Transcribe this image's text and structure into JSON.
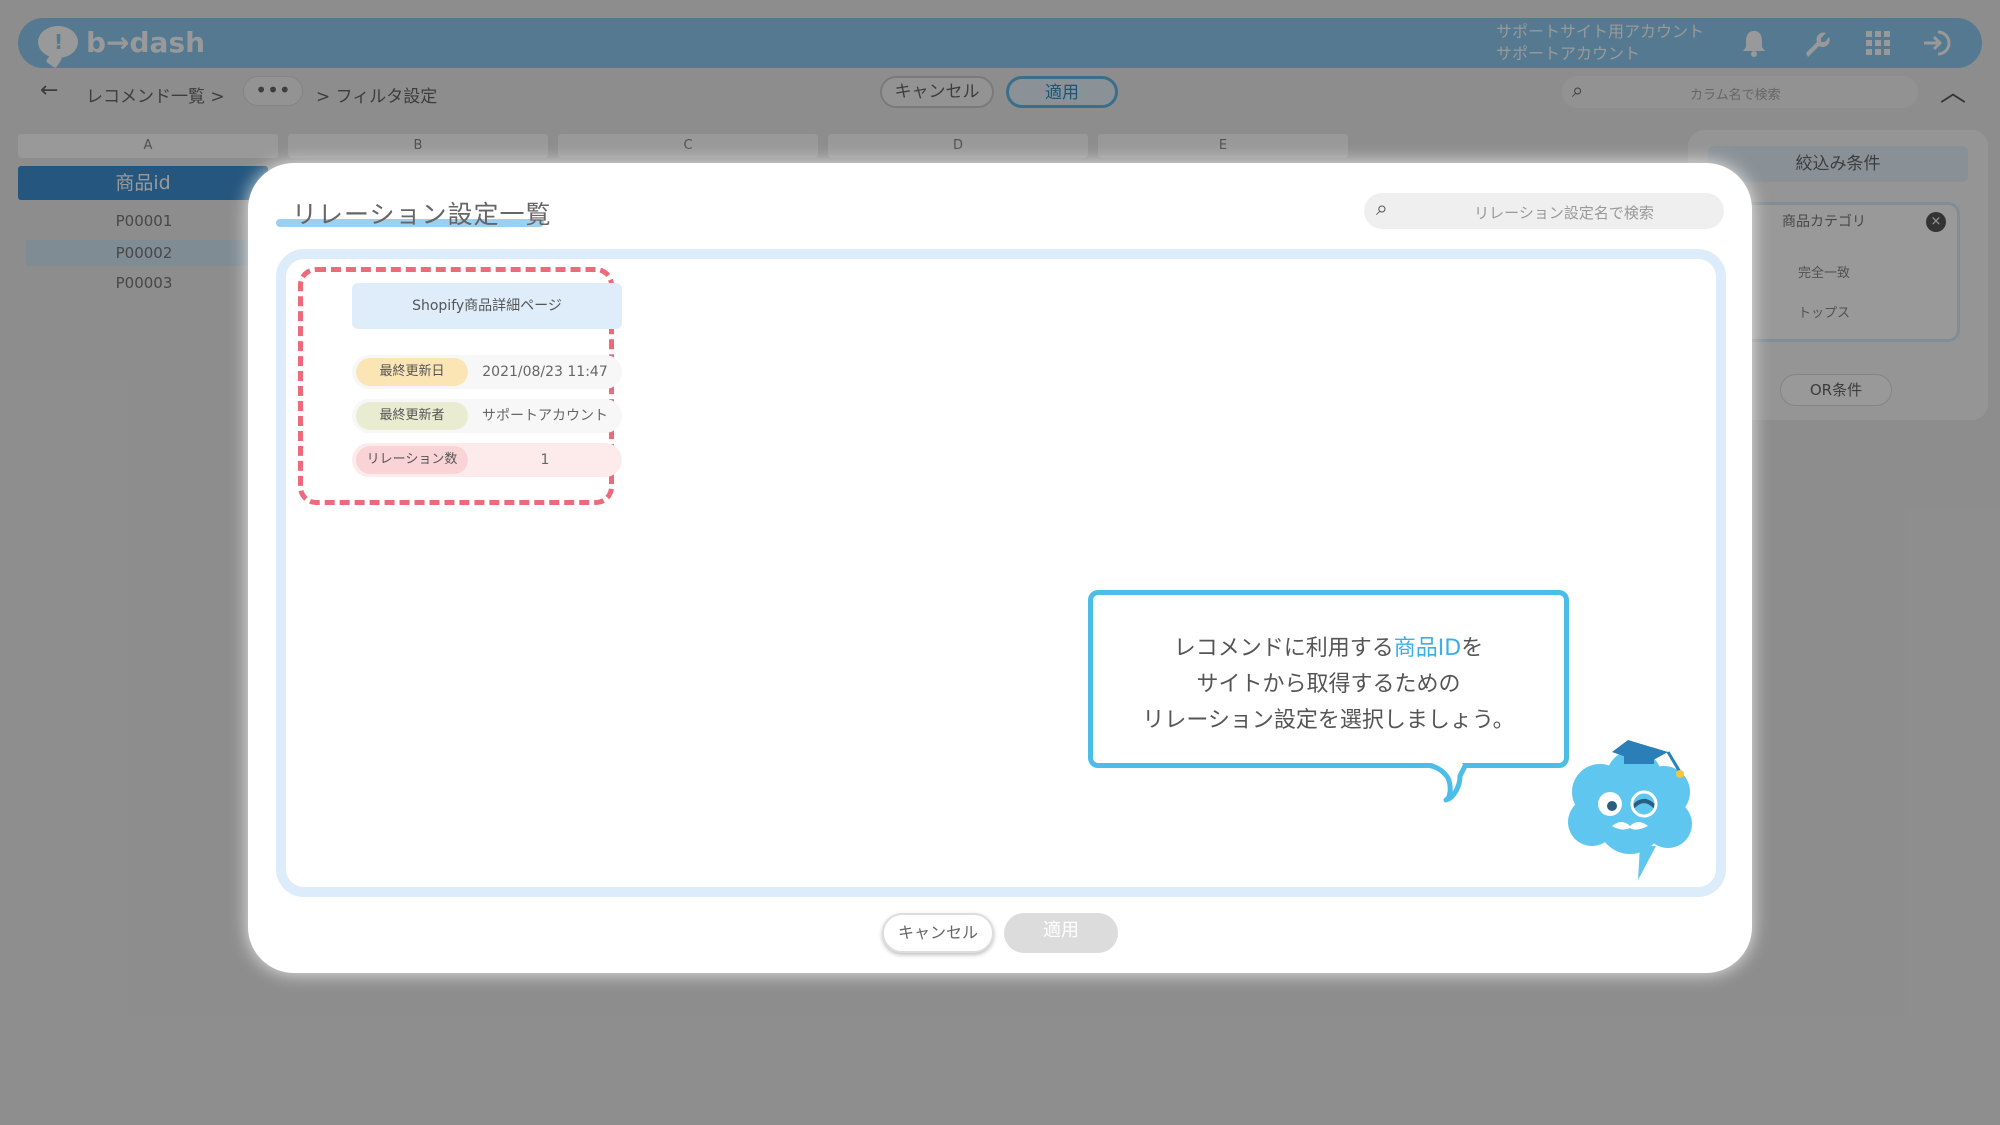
{
  "app": {
    "logo_text": "b→dash",
    "account_line1": "サポートサイト用アカウント",
    "account_line2": "サポートアカウント"
  },
  "breadcrumb": {
    "back": "←",
    "item1": "レコメンド一覧 >",
    "more": "•••",
    "item2": "> フィルタ設定"
  },
  "subbar": {
    "cancel": "キャンセル",
    "apply": "適用",
    "column_search_placeholder": "カラム名で検索"
  },
  "sheet": {
    "columns": [
      "A",
      "B",
      "C",
      "D",
      "E"
    ],
    "id_header": "商品id",
    "rows": [
      "P00001",
      "P00002",
      "P00003"
    ]
  },
  "filter_panel": {
    "title": "絞込み条件",
    "tag": "商品カテゴリ",
    "match": "完全一致",
    "value": "トップス",
    "or_button": "OR条件"
  },
  "modal": {
    "title": "リレーション設定一覧",
    "search_placeholder": "リレーション設定名で検索",
    "card": {
      "name": "Shopify商品詳細ページ",
      "updated_label": "最終更新日",
      "updated_value": "2021/08/23 11:47",
      "updater_label": "最終更新者",
      "updater_value": "サポートアカウント",
      "relations_label": "リレーション数",
      "relations_value": "1"
    },
    "cancel": "キャンセル",
    "apply": "適用"
  },
  "tooltip": {
    "line1_pre": "レコメンドに利用する",
    "line1_highlight": "商品ID",
    "line1_post": "を",
    "line2": "サイトから取得するための",
    "line3": "リレーション設定を選択しましょう。"
  },
  "colors": {
    "accent": "#4cbde8",
    "highlight_border": "#ec6a7a",
    "topbar": "#8ccaf0"
  }
}
